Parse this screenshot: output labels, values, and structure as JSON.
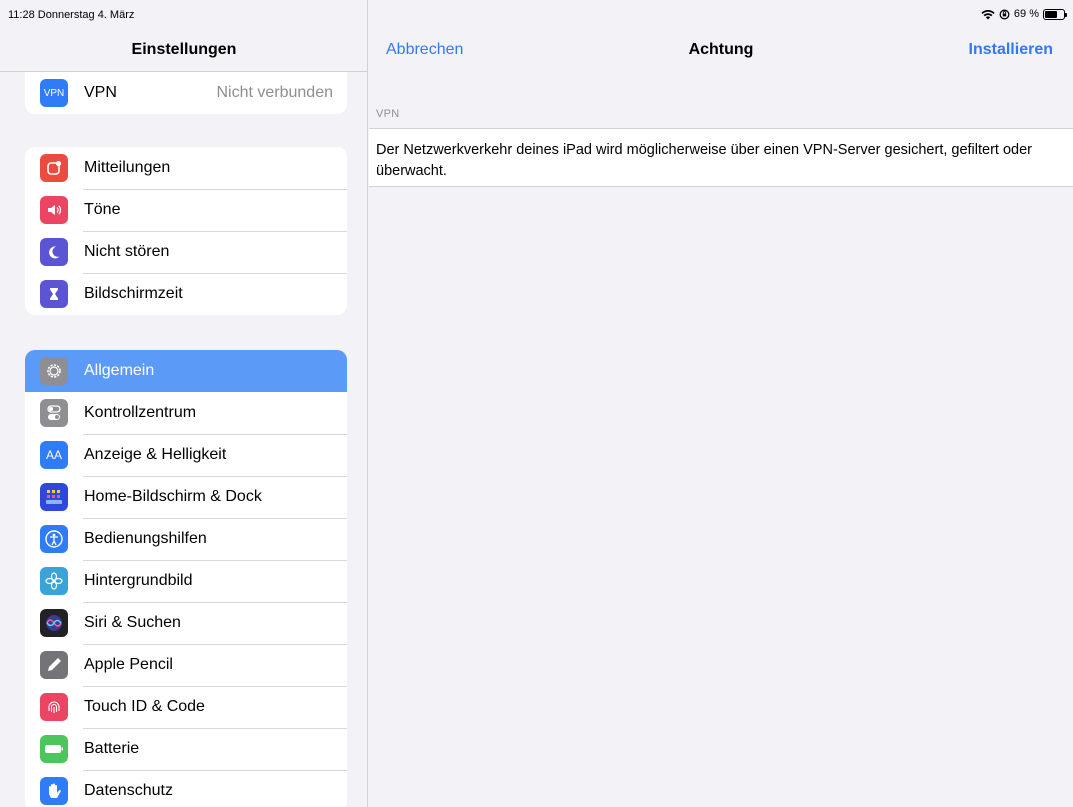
{
  "status_bar": {
    "time_date": "11:28  Donnerstag 4. März",
    "battery_text": "69 %",
    "battery_level": 0.69
  },
  "sidebar": {
    "title": "Einstellungen",
    "groups": [
      {
        "items": [
          {
            "label": "VPN",
            "value": "Nicht verbunden",
            "icon": "vpn-icon",
            "icon_text": "VPN",
            "color": "#2f7cf6"
          }
        ]
      },
      {
        "items": [
          {
            "label": "Mitteilungen",
            "icon": "notifications-icon",
            "color": "#ec4b3f"
          },
          {
            "label": "Töne",
            "icon": "speaker-icon",
            "color": "#ec4564"
          },
          {
            "label": "Nicht stören",
            "icon": "moon-icon",
            "color": "#5b55d6"
          },
          {
            "label": "Bildschirmzeit",
            "icon": "hourglass-icon",
            "color": "#5b55d6"
          }
        ]
      },
      {
        "items": [
          {
            "label": "Allgemein",
            "icon": "gear-icon",
            "color": "#8e8e93",
            "selected": true
          },
          {
            "label": "Kontrollzentrum",
            "icon": "toggles-icon",
            "color": "#8e8e93"
          },
          {
            "label": "Anzeige & Helligkeit",
            "icon": "text-size-icon",
            "icon_text": "AA",
            "color": "#2f7cf6"
          },
          {
            "label": "Home-Bildschirm & Dock",
            "icon": "app-grid-icon",
            "color": "#2f48d8"
          },
          {
            "label": "Bedienungshilfen",
            "icon": "accessibility-icon",
            "color": "#2f7cf6"
          },
          {
            "label": "Hintergrundbild",
            "icon": "flower-icon",
            "color": "#3aa3d8"
          },
          {
            "label": "Siri & Suchen",
            "icon": "siri-icon",
            "color": "#222226"
          },
          {
            "label": "Apple Pencil",
            "icon": "pencil-icon",
            "color": "#737378"
          },
          {
            "label": "Touch ID & Code",
            "icon": "fingerprint-icon",
            "color": "#ec4564"
          },
          {
            "label": "Batterie",
            "icon": "battery-icon",
            "color": "#4cc55c"
          },
          {
            "label": "Datenschutz",
            "icon": "hand-icon",
            "color": "#2f7cf6"
          }
        ]
      }
    ]
  },
  "main": {
    "nav": {
      "cancel_label": "Abbrechen",
      "title": "Achtung",
      "install_label": "Installieren"
    },
    "section_label": "VPN",
    "message": "Der Netzwerkverkehr deines iPad wird möglicherweise über einen VPN-Server gesichert, gefiltert oder überwacht."
  },
  "colors": {
    "accent": "#3478f6",
    "selected_row": "#5b9bf7",
    "background": "#f2f2f7"
  }
}
